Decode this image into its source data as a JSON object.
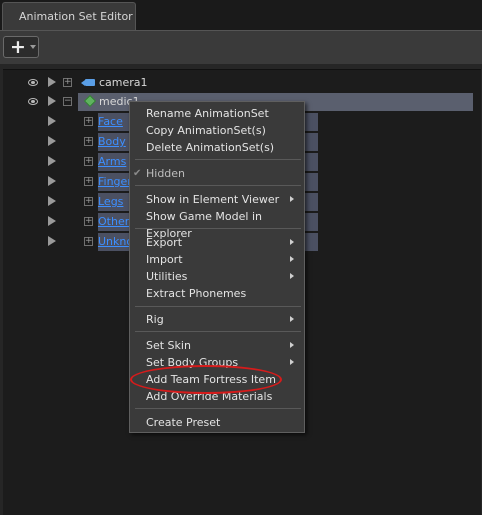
{
  "window": {
    "tab_title": "Animation Set Editor"
  },
  "toolbar": {
    "add_label": "+"
  },
  "tree": {
    "camera": {
      "label": "camera1"
    },
    "model": {
      "label": "medic1"
    },
    "groups": [
      {
        "label": "Face"
      },
      {
        "label": "Body"
      },
      {
        "label": "Arms"
      },
      {
        "label": "Finger"
      },
      {
        "label": "Legs"
      },
      {
        "label": "Other"
      },
      {
        "label": "Unkno"
      }
    ]
  },
  "context_menu": {
    "items": [
      {
        "label": "Rename AnimationSet"
      },
      {
        "label": "Copy AnimationSet(s)"
      },
      {
        "label": "Delete AnimationSet(s)"
      },
      {
        "label": "Hidden",
        "checked": true
      },
      {
        "label": "Show in Element Viewer",
        "submenu": true
      },
      {
        "label": "Show Game Model in Explorer"
      },
      {
        "label": "Export",
        "submenu": true
      },
      {
        "label": "Import",
        "submenu": true
      },
      {
        "label": "Utilities",
        "submenu": true
      },
      {
        "label": "Extract Phonemes"
      },
      {
        "label": "Rig",
        "submenu": true
      },
      {
        "label": "Set Skin",
        "submenu": true
      },
      {
        "label": "Set Body Groups",
        "submenu": true
      },
      {
        "label": "Add Team Fortress Item"
      },
      {
        "label": "Add Override Materials"
      },
      {
        "label": "Create Preset"
      }
    ]
  },
  "annotation": {
    "color": "#d61b1b",
    "highlighted_item": "Add Team Fortress Item"
  },
  "colors": {
    "link": "#3d8fff",
    "selection": "#5a5f6e",
    "background": "#1c1c1c"
  }
}
